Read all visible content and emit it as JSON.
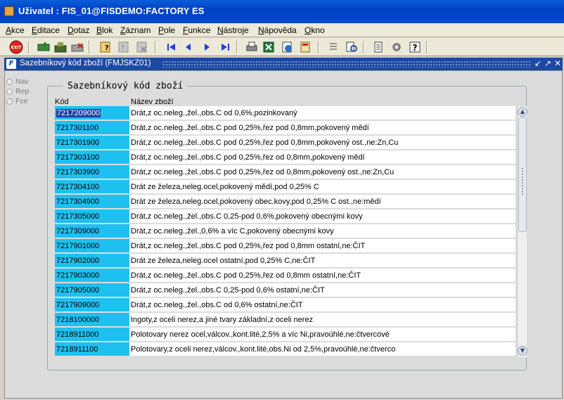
{
  "window": {
    "title": "Uživatel : FIS_01@FISDEMO:FACTORY ES"
  },
  "menu": [
    {
      "label": "Akce",
      "accel": "A",
      "rest": "kce"
    },
    {
      "label": "Editace",
      "accel": "E",
      "rest": "ditace"
    },
    {
      "label": "Dotaz",
      "accel": "D",
      "rest": "otaz"
    },
    {
      "label": "Blok",
      "accel": "B",
      "rest": "lok"
    },
    {
      "label": "Záznam",
      "accel": "Z",
      "rest": "áznam"
    },
    {
      "label": "Pole",
      "accel": "P",
      "rest": "ole"
    },
    {
      "label": "Funkce",
      "accel": "F",
      "rest": "unkce"
    },
    {
      "label": "Nástroje",
      "accel": "N",
      "rest": "ástroje"
    },
    {
      "label": "Nápověda",
      "accel": "N",
      "rest": "ápověda"
    },
    {
      "label": "Okno",
      "accel": "O",
      "rest": "kno"
    }
  ],
  "toolbar": {
    "exit_label": "EXIT",
    "help_label": "?"
  },
  "form": {
    "title": "Sazebníkový kód zboží (FMJSKZ01)",
    "group_title": "Sazebníkový kód zboží",
    "modes": [
      "Nav",
      "Rep",
      "Fce"
    ],
    "columns": {
      "code": "Kód",
      "name": "Název zboží"
    },
    "rows": [
      {
        "code": "7217209000",
        "name": "Drát,z oc.neleg.,žel.,obs.C od 0,6%,pozinkovaný"
      },
      {
        "code": "7217301100",
        "name": "Drát,z oc.neleg.,žel.,obs.C pod 0,25%,řez pod 0,8mm,pokovený mědí"
      },
      {
        "code": "7217301900",
        "name": "Drát,z oc.neleg.,žel.,obs.C pod 0,25%,řez pod 0,8mm,pokovený ost.,ne:Zn,Cu"
      },
      {
        "code": "7217303100",
        "name": "Drát,z oc.neleg.,žel.,obs.C pod 0,25%,řez od 0,8mm,pokovený mědí"
      },
      {
        "code": "7217303900",
        "name": "Drát,z oc.neleg.,žel.,obs.C pod 0,25%,řez od 0,8mm,pokovený ost.,ne:Zn,Cu"
      },
      {
        "code": "7217304100",
        "name": "Drát ze železa,neleg.ocel,pokovený mědí,pod 0,25% C"
      },
      {
        "code": "7217304900",
        "name": "Drát ze železa,neleg.ocel,pokovený obec.kovy,pod 0,25% C ost.,ne:mědí"
      },
      {
        "code": "7217305000",
        "name": "Drát,z oc.neleg.,žel.,obs.C 0,25-pod 0,6%,pokovený obecnými kovy"
      },
      {
        "code": "7217309000",
        "name": "Drát,z oc.neleg.,žel.,0,6% a víc C,pokovený obecnými kovy"
      },
      {
        "code": "7217901000",
        "name": "Drát,z oc.neleg.,žel.,obs.C pod 0,25%,řez pod 0,8mm ostatní,ne:ČIT"
      },
      {
        "code": "7217902000",
        "name": "Drát ze železa,neleg.ocel ostatní,pod 0,25% C,ne:ČIT"
      },
      {
        "code": "7217903000",
        "name": "Drát,z oc.neleg.,žel.,obs.C pod 0,25%,řez od 0,8mm ostatní,ne:ČIT"
      },
      {
        "code": "7217905000",
        "name": "Drát,z oc.neleg.,žel.,obs.C 0,25-pod 0,6% ostatní,ne:ČIT"
      },
      {
        "code": "7217909000",
        "name": "Drát,z oc.neleg.,žel.,obs.C od 0,6% ostatní,ne:ČIT"
      },
      {
        "code": "7218100000",
        "name": "Ingoty,z oceli nerez,a jiné tvary základní,z oceli nerez"
      },
      {
        "code": "7218911000",
        "name": "Polotovary nerez ocel,válcov.,kont.lité,2,5% a víc Ni,pravoúhlé,ne:čtvercové"
      },
      {
        "code": "7218911100",
        "name": "Polotovary,z oceli nerez,válcov.,kont.lité,obs.Ni od 2,5%,pravoúhlé,ne:čtverco"
      }
    ]
  }
}
